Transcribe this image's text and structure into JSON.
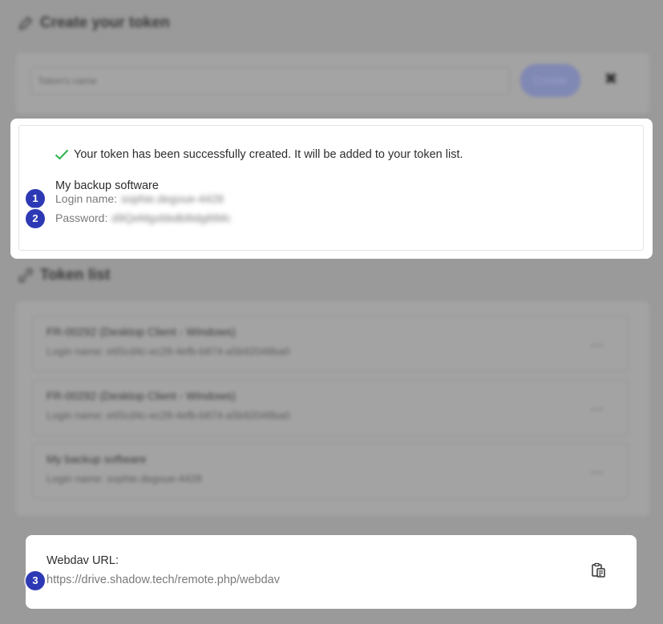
{
  "create_section": {
    "title": "Create your token",
    "token_name_placeholder": "Token's name",
    "create_button_label": "Create",
    "close_label": "✖"
  },
  "success": {
    "message": "Your token has been successfully created. It will be added to your token list.",
    "token_name": "My backup software",
    "login_label": "Login name:",
    "login_value": "sophie.degoue-4428",
    "password_label": "Password:",
    "password_value": "d9QeMgxbbdb8idg6tMc"
  },
  "token_list": {
    "title": "Token list",
    "items": [
      {
        "title": "FR-00292 (Desktop Client - Windows)",
        "login": "Login name: e65cd4c-ec28-4efb-b874-a5b92048ba0",
        "menu": "..."
      },
      {
        "title": "FR-00292 (Desktop Client - Windows)",
        "login": "Login name: e65cd4c-ec28-4efb-b874-a5b92048ba0",
        "menu": "..."
      },
      {
        "title": "My backup software",
        "login": "Login name: sophie.degoue-4428",
        "menu": "..."
      }
    ]
  },
  "webdav": {
    "label": "Webdav URL:",
    "url": "https://drive.shadow.tech/remote.php/webdav"
  },
  "steps": [
    "1",
    "2",
    "3"
  ],
  "colors": {
    "success_check": "#2bb24c",
    "badge": "#2d39b4",
    "overlay": "#9a9a9a"
  }
}
